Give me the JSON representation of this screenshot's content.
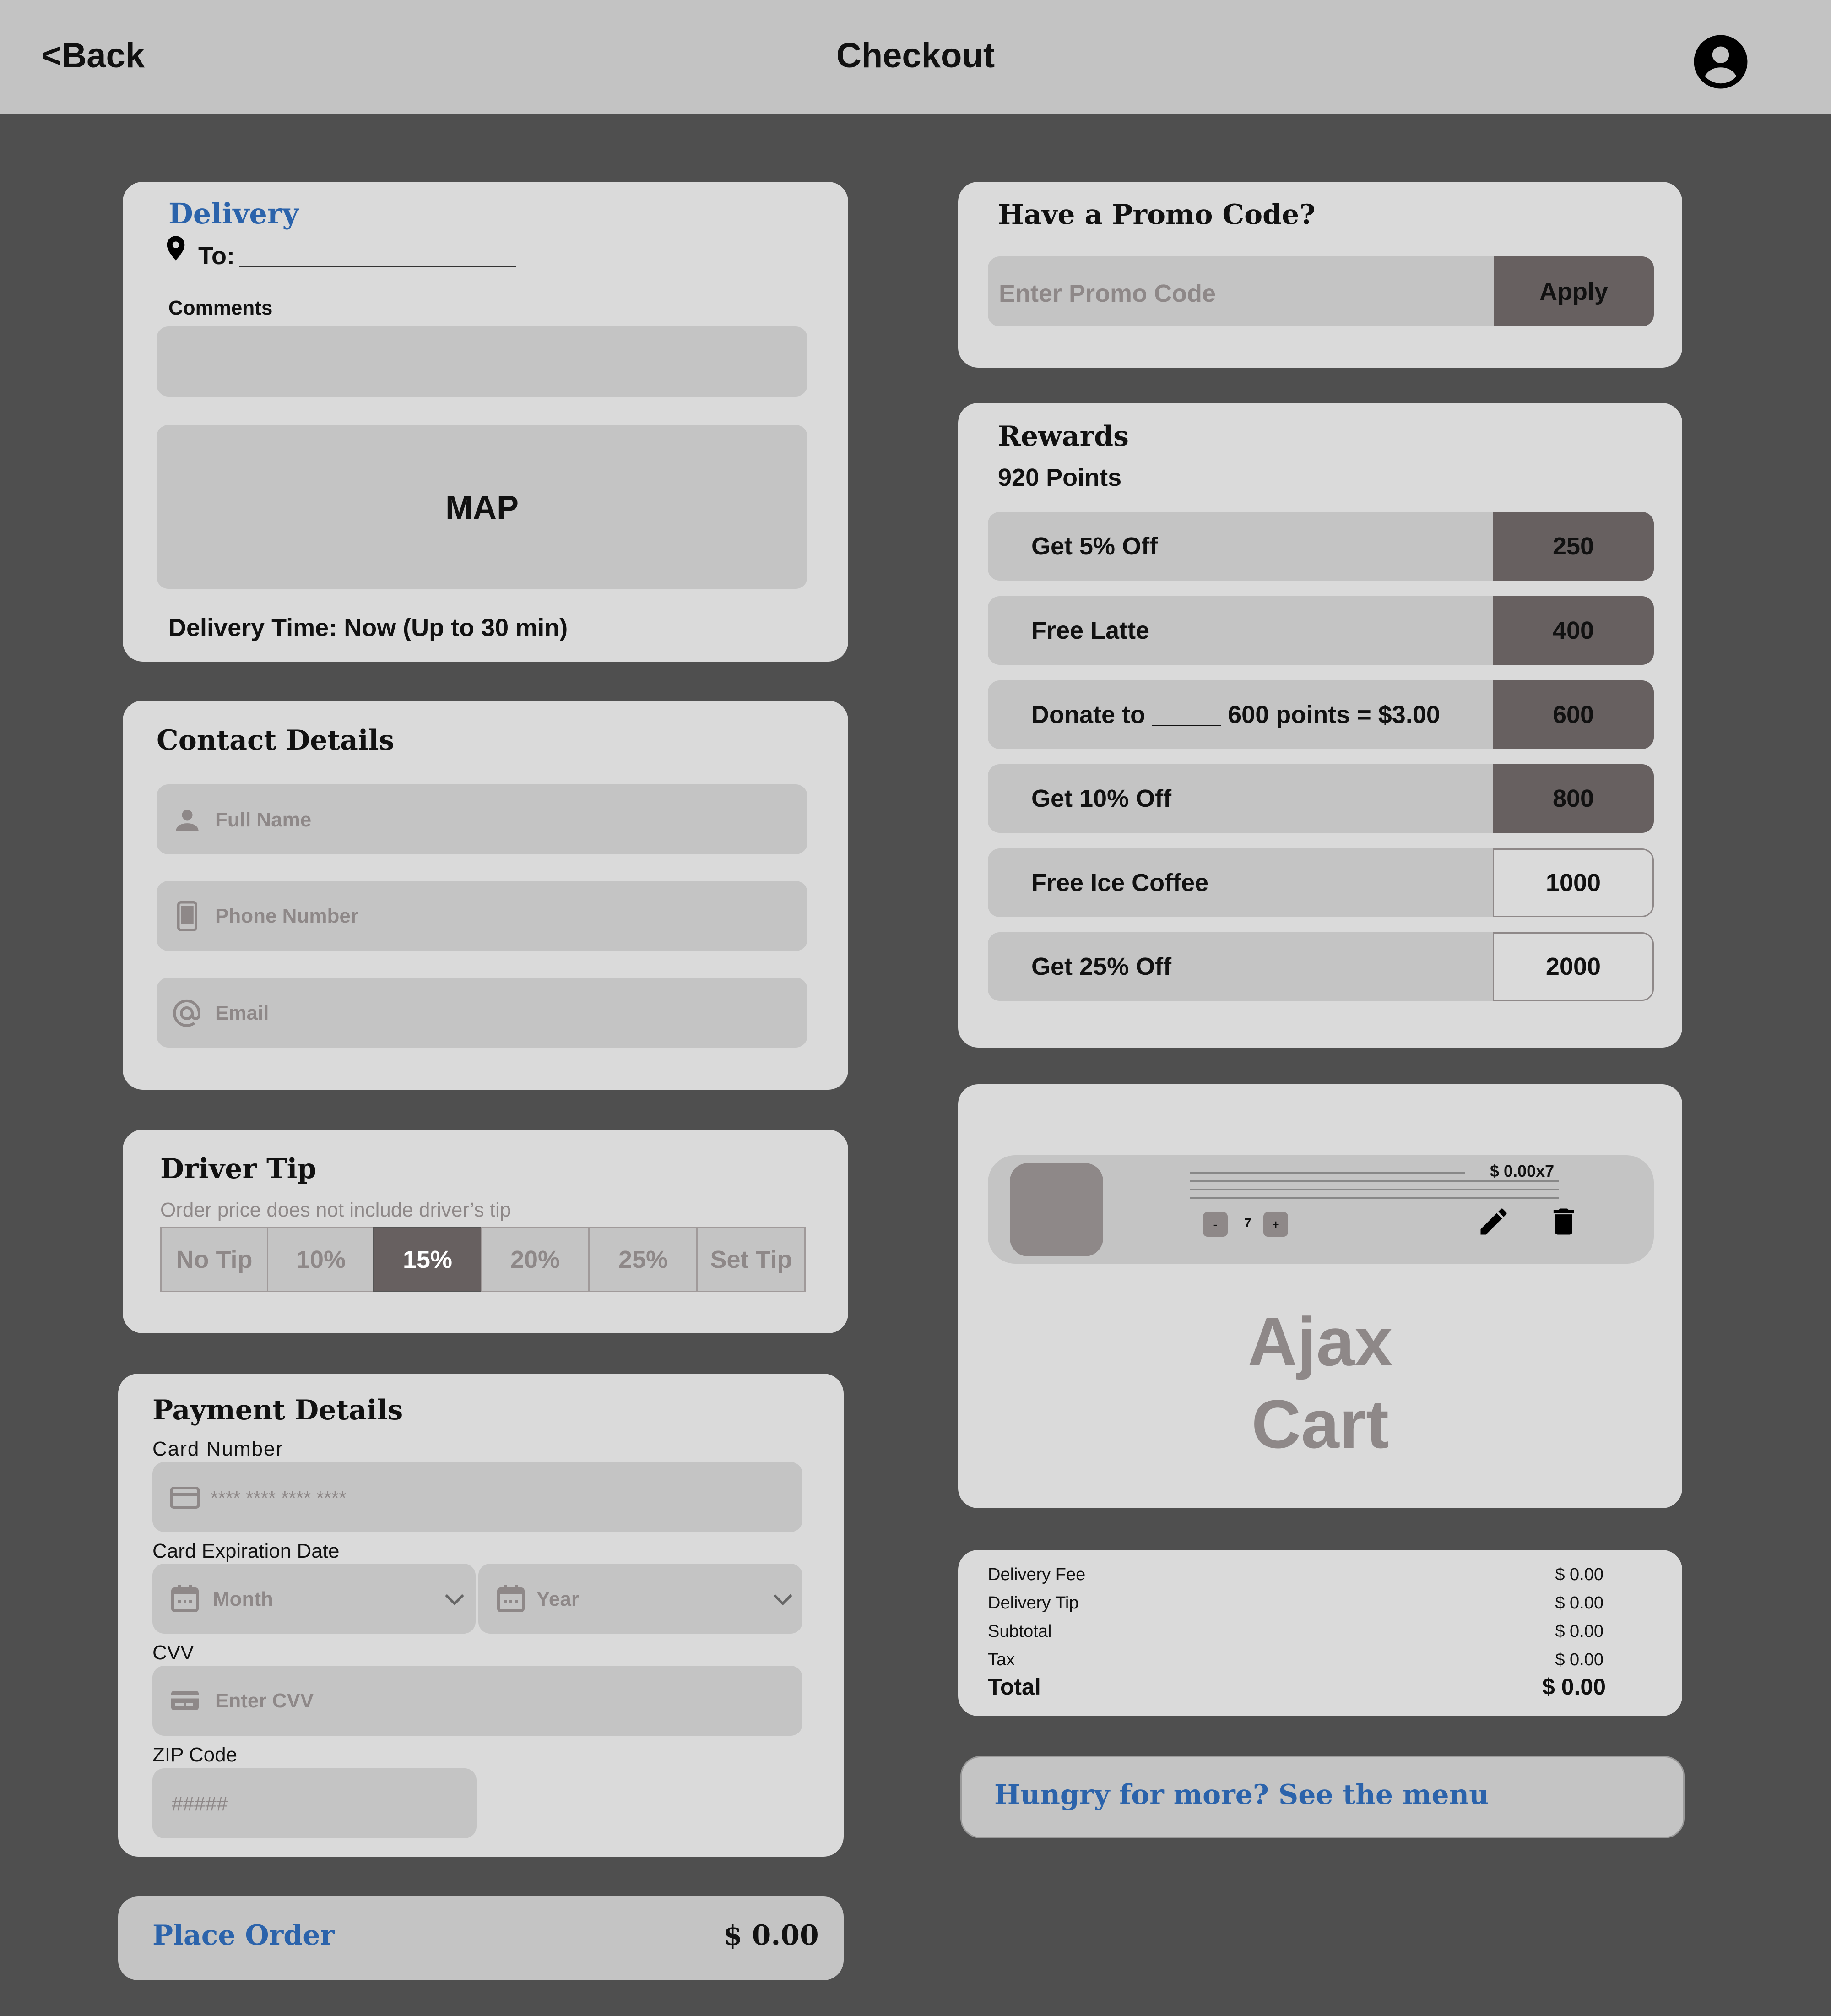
{
  "header": {
    "back_label": "<Back",
    "title": "Checkout"
  },
  "delivery": {
    "heading": "Delivery",
    "to_label": "To:",
    "comments_label": "Comments",
    "map_label": "MAP",
    "delivery_time": "Delivery Time: Now (Up to 30 min)"
  },
  "contact": {
    "heading": "Contact Details",
    "full_name_placeholder": "Full Name",
    "phone_placeholder": "Phone Number",
    "email_placeholder": "Email"
  },
  "tip": {
    "heading": "Driver Tip",
    "note": "Order price does not include driver’s tip",
    "options": [
      "No Tip",
      "10%",
      "15%",
      "20%",
      "25%",
      "Set Tip"
    ],
    "selected": "15%"
  },
  "payment": {
    "heading": "Payment Details",
    "card_number_label": "Card Number",
    "card_number_placeholder": "**** **** **** ****",
    "expiration_label": "Card Expiration Date",
    "month_placeholder": "Month",
    "year_placeholder": "Year",
    "cvv_label": "CVV",
    "cvv_placeholder": "Enter CVV",
    "zip_label": "ZIP Code",
    "zip_placeholder": "#####"
  },
  "place_order": {
    "label": "Place Order",
    "amount": "$ 0.00"
  },
  "promo": {
    "heading": "Have a Promo Code?",
    "placeholder": "Enter Promo Code",
    "apply_label": "Apply"
  },
  "rewards": {
    "heading": "Rewards",
    "points": "920 Points",
    "items": [
      {
        "label": "Get 5% Off",
        "points": "250",
        "available": true
      },
      {
        "label": "Free Latte",
        "points": "400",
        "available": true
      },
      {
        "label": "Donate to _____ 600 points = $3.00",
        "points": "600",
        "available": true
      },
      {
        "label": "Get 10% Off",
        "points": "800",
        "available": true
      },
      {
        "label": "Free Ice Coffee",
        "points": "1000",
        "available": false
      },
      {
        "label": "Get 25% Off",
        "points": "2000",
        "available": false
      }
    ]
  },
  "cart": {
    "item_price": "$ 0.00x7",
    "quantity": "7",
    "minus_label": "-",
    "plus_label": "+",
    "watermark_line1": "Ajax",
    "watermark_line2": "Cart"
  },
  "summary": {
    "rows": [
      {
        "label": "Delivery Fee",
        "value": "$ 0.00"
      },
      {
        "label": "Delivery Tip",
        "value": "$ 0.00"
      },
      {
        "label": "Subtotal",
        "value": "$ 0.00"
      },
      {
        "label": "Tax",
        "value": "$ 0.00"
      }
    ],
    "total_label": "Total",
    "total_value": "$ 0.00"
  },
  "menu_link": {
    "label": "Hungry for more? See the menu"
  },
  "colors": {
    "background": "#4f4f4f",
    "card": "#dadada",
    "field": "#c4c4c4",
    "accent_dark": "#676060",
    "link_blue": "#2b63ab"
  }
}
